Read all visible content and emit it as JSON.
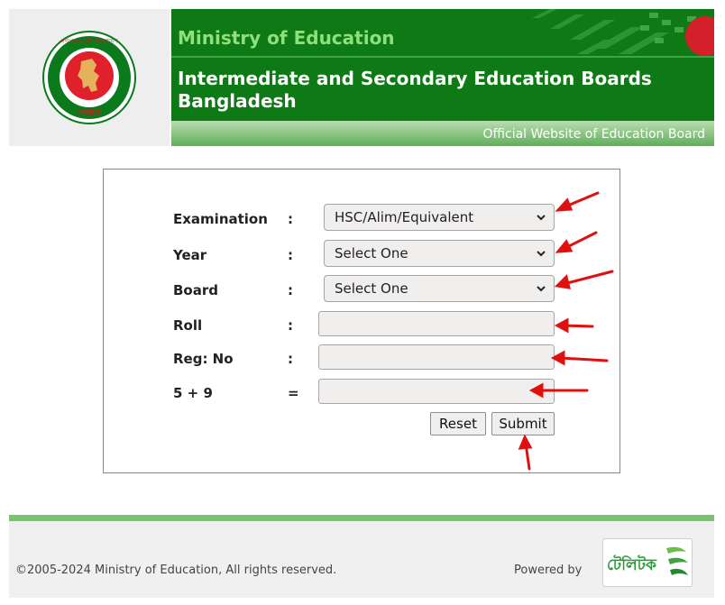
{
  "header": {
    "ministry": "Ministry of Education",
    "boards_line1": "Intermediate and Secondary Education Boards",
    "boards_line2": "Bangladesh",
    "official": "Official Website of Education Board",
    "logo_text_top": "গণপ্রজাতন্ত্রী বাংলাদেশ",
    "logo_text_bottom": "সরকার"
  },
  "form": {
    "examination": {
      "label": "Examination",
      "colon": ":",
      "value": "HSC/Alim/Equivalent"
    },
    "year": {
      "label": "Year",
      "colon": ":",
      "value": "Select One"
    },
    "board": {
      "label": "Board",
      "colon": ":",
      "value": "Select One"
    },
    "roll": {
      "label": "Roll",
      "colon": ":",
      "value": ""
    },
    "reg": {
      "label": "Reg: No",
      "colon": ":",
      "value": ""
    },
    "captcha": {
      "label": "5 + 9",
      "colon": "=",
      "value": ""
    },
    "reset_label": "Reset",
    "submit_label": "Submit"
  },
  "footer": {
    "copyright": "©2005-2024 Ministry of Education, All rights reserved.",
    "powered_by": "Powered by",
    "teletalk_text": "টেলিটক"
  },
  "colors": {
    "banner_green": "#0d7a16",
    "ministry_text": "#8ee07a",
    "arrow_red": "#e01010",
    "footer_line": "#79c56e"
  }
}
